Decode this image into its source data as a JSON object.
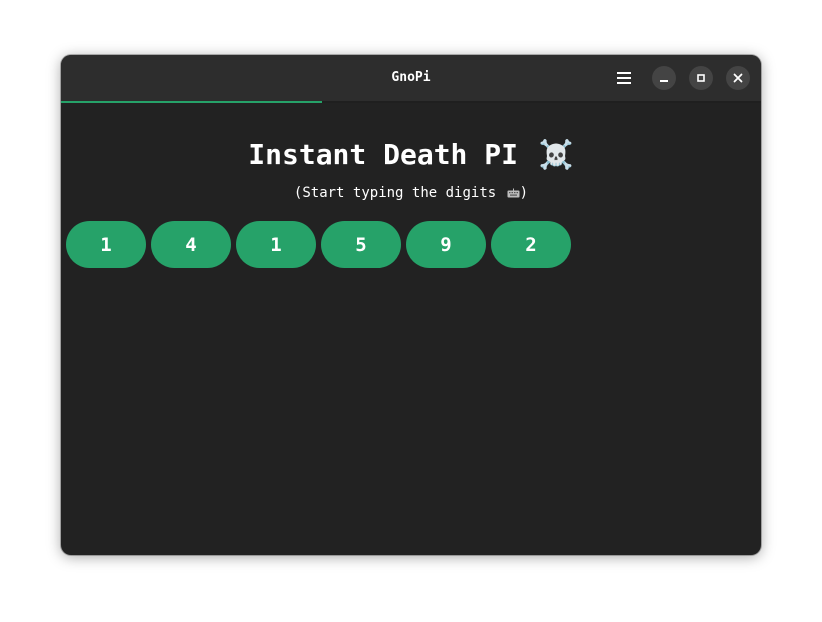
{
  "window": {
    "title": "GnoPi"
  },
  "progress": {
    "fraction": 0.373,
    "color": "#26a269"
  },
  "titlebar": {
    "menu_icon": "hamburger-menu-icon",
    "minimize_icon": "minimize-icon",
    "maximize_icon": "maximize-icon",
    "close_icon": "close-icon"
  },
  "main": {
    "heading": "Instant Death PI",
    "heading_icon": "☠️",
    "subtitle_prefix": "(Start typing the digits",
    "subtitle_suffix": ")",
    "subtitle_icon": "keyboard-icon",
    "digits": [
      "1",
      "4",
      "1",
      "5",
      "9",
      "2"
    ],
    "digit_color": "#26a269"
  }
}
